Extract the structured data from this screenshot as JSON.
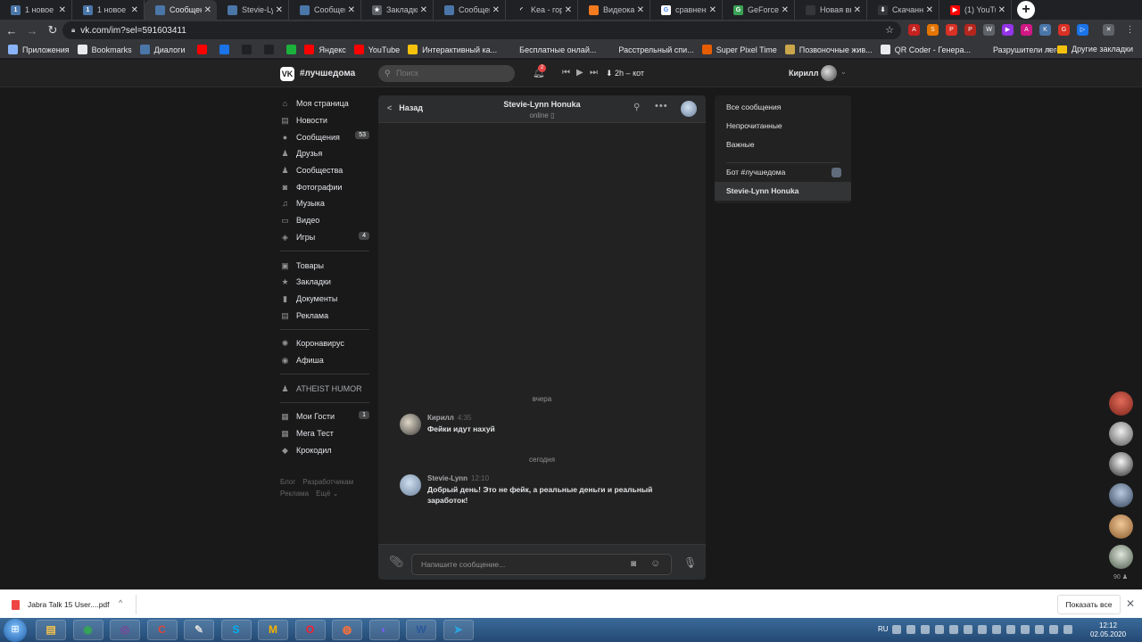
{
  "browser": {
    "tabs": [
      {
        "title": "1 новое со",
        "icon": "vk-icon",
        "color": "#4a76a8",
        "glyph": "1"
      },
      {
        "title": "1 новое со",
        "icon": "vk-icon",
        "color": "#4a76a8",
        "glyph": "1"
      },
      {
        "title": "Сообщени",
        "icon": "messages-icon",
        "color": "#4a76a8",
        "glyph": "",
        "active": true
      },
      {
        "title": "Stevie-Lyn",
        "icon": "vk-icon",
        "color": "#4a76a8",
        "glyph": ""
      },
      {
        "title": "Сообщени",
        "icon": "messages-icon",
        "color": "#4a76a8",
        "glyph": ""
      },
      {
        "title": "Закладки",
        "icon": "star-icon",
        "color": "#5f6368",
        "glyph": "★"
      },
      {
        "title": "Сообщени",
        "icon": "messages-icon",
        "color": "#4a76a8",
        "glyph": ""
      },
      {
        "title": "Kea - горн",
        "icon": "loading-icon",
        "color": "#202124",
        "glyph": "◜"
      },
      {
        "title": "Видеокарт",
        "icon": "shop-icon",
        "color": "#f47a20",
        "glyph": ""
      },
      {
        "title": "сравнени",
        "icon": "google-icon",
        "color": "#ffffff",
        "glyph": "G"
      },
      {
        "title": "GeForce G",
        "icon": "geforce-icon",
        "color": "#3aa356",
        "glyph": "G"
      },
      {
        "title": "Новая вкладка",
        "icon": "newtab-icon",
        "color": "#35363a",
        "glyph": ""
      },
      {
        "title": "Скачанны",
        "icon": "download-icon",
        "color": "#35363a",
        "glyph": "⬇"
      },
      {
        "title": "(1) YouTub",
        "icon": "youtube-icon",
        "color": "#ff0000",
        "glyph": "▶"
      }
    ],
    "url": "vk.com/im?sel=591603411",
    "bookmarks": [
      {
        "label": "Приложения",
        "color": "#8ab4f8"
      },
      {
        "label": "Bookmarks",
        "color": "#e8eaed"
      },
      {
        "label": "Диалоги",
        "color": "#4a76a8"
      },
      {
        "label": "",
        "color": "#ff0000"
      },
      {
        "label": "",
        "color": "#1a73e8"
      },
      {
        "label": "",
        "color": "#202124"
      },
      {
        "label": "",
        "color": "#202124"
      },
      {
        "label": "",
        "color": "#1bb13b"
      },
      {
        "label": "Яндекс",
        "color": "#ff0000"
      },
      {
        "label": "YouTube",
        "color": "#ff0000"
      },
      {
        "label": "Интерактивный ка...",
        "color": "#f4c20d"
      },
      {
        "label": "Бесплатные онлай...",
        "color": "#35363a"
      },
      {
        "label": "Расстрельный спи...",
        "color": "#35363a"
      },
      {
        "label": "Super Pixel Time",
        "color": "#e65c00"
      },
      {
        "label": "Позвоночные жив...",
        "color": "#c9a64a"
      },
      {
        "label": "QR Coder - Генера...",
        "color": "#e8eaed"
      },
      {
        "label": "Разрушители леге...",
        "color": "#35363a"
      }
    ],
    "bookmarks_other": "Другие закладки"
  },
  "vk": {
    "brand": "VK",
    "community": "#лучшедома",
    "search_placeholder": "Поиск",
    "notifications_badge": "2",
    "track": "2h – кот",
    "user_name": "Кирилл"
  },
  "nav": {
    "group1": [
      {
        "label": "Моя страница",
        "icon": "home-icon",
        "glyph": "⌂"
      },
      {
        "label": "Новости",
        "icon": "news-icon",
        "glyph": "▤"
      },
      {
        "label": "Сообщения",
        "icon": "messages-icon",
        "glyph": "●",
        "count": "53"
      },
      {
        "label": "Друзья",
        "icon": "friends-icon",
        "glyph": "♟"
      },
      {
        "label": "Сообщества",
        "icon": "communities-icon",
        "glyph": "♟"
      },
      {
        "label": "Фотографии",
        "icon": "photos-icon",
        "glyph": "◙"
      },
      {
        "label": "Музыка",
        "icon": "music-icon",
        "glyph": "♫"
      },
      {
        "label": "Видео",
        "icon": "video-icon",
        "glyph": "▭"
      },
      {
        "label": "Игры",
        "icon": "games-icon",
        "glyph": "◈",
        "count": "4"
      }
    ],
    "group2": [
      {
        "label": "Товары",
        "icon": "goods-icon",
        "glyph": "▣"
      },
      {
        "label": "Закладки",
        "icon": "bookmarks-icon",
        "glyph": "★"
      },
      {
        "label": "Документы",
        "icon": "documents-icon",
        "glyph": "▮"
      },
      {
        "label": "Реклама",
        "icon": "ads-icon",
        "glyph": "▤"
      }
    ],
    "group3": [
      {
        "label": "Коронавирус",
        "icon": "virus-icon",
        "glyph": "✺"
      },
      {
        "label": "Афиша",
        "icon": "afisha-icon",
        "glyph": "◉"
      }
    ],
    "group4": [
      {
        "label": "ATHEIST HUMOR",
        "icon": "group-icon",
        "glyph": "♟"
      }
    ],
    "group5": [
      {
        "label": "Мои Гости",
        "icon": "guests-icon",
        "glyph": "▦",
        "count": "1"
      },
      {
        "label": "Мега Тест",
        "icon": "test-icon",
        "glyph": "▦"
      },
      {
        "label": "Крокодил",
        "icon": "crocodile-icon",
        "glyph": "◆"
      }
    ],
    "footer": [
      "Блог",
      "Разработчикам",
      "Реклама",
      "Ещё ⌄"
    ]
  },
  "chat": {
    "back_label": "Назад",
    "title": "Stevie-Lynn Honuka",
    "status": "online ▯",
    "composer_placeholder": "Напишите сообщение...",
    "day_yesterday": "вчера",
    "day_today": "сегодня",
    "messages": [
      {
        "author": "Кирилл",
        "time": "4:35",
        "text": "Фейки идут нахуй"
      },
      {
        "author": "Stevie-Lynn",
        "time": "12:10",
        "text": "Добрый день! Это не фейк, а реальные деньги и реальный заработок!"
      }
    ]
  },
  "filters": {
    "items": [
      "Все сообщения",
      "Непрочитанные",
      "Важные"
    ],
    "conversations": [
      "Бот #лучшедома",
      "Stevie-Lynn Honuka"
    ]
  },
  "friends_online_count": "90",
  "downloads": {
    "file": "Jabra Talk 15 User....pdf",
    "show_all": "Показать все"
  },
  "taskbar": {
    "lang": "RU",
    "time": "12:12",
    "date": "02.05.2020",
    "apps": [
      {
        "name": "explorer",
        "glyph": "▤",
        "color": "#f2c14e"
      },
      {
        "name": "chrome",
        "glyph": "◉",
        "color": "#34a853"
      },
      {
        "name": "tor",
        "glyph": "◎",
        "color": "#7d4698"
      },
      {
        "name": "ccleaner",
        "glyph": "C",
        "color": "#e0453a"
      },
      {
        "name": "editor",
        "glyph": "✎",
        "color": "#ddd"
      },
      {
        "name": "skype",
        "glyph": "S",
        "color": "#00aff0"
      },
      {
        "name": "m-app",
        "glyph": "M",
        "color": "#f5b400"
      },
      {
        "name": "opera",
        "glyph": "O",
        "color": "#ff1b2d"
      },
      {
        "name": "firefox",
        "glyph": "◍",
        "color": "#ff7139"
      },
      {
        "name": "viber",
        "glyph": "◐",
        "color": "#7360f2"
      },
      {
        "name": "word",
        "glyph": "W",
        "color": "#2b579a"
      },
      {
        "name": "telegram",
        "glyph": "➤",
        "color": "#2ca5e0"
      }
    ]
  },
  "colors": {
    "background": "#19191a",
    "panel": "#222222",
    "header": "#2c2d2e",
    "text": "#e1e3e6",
    "muted": "#939393",
    "badge_red": "#e64646"
  }
}
